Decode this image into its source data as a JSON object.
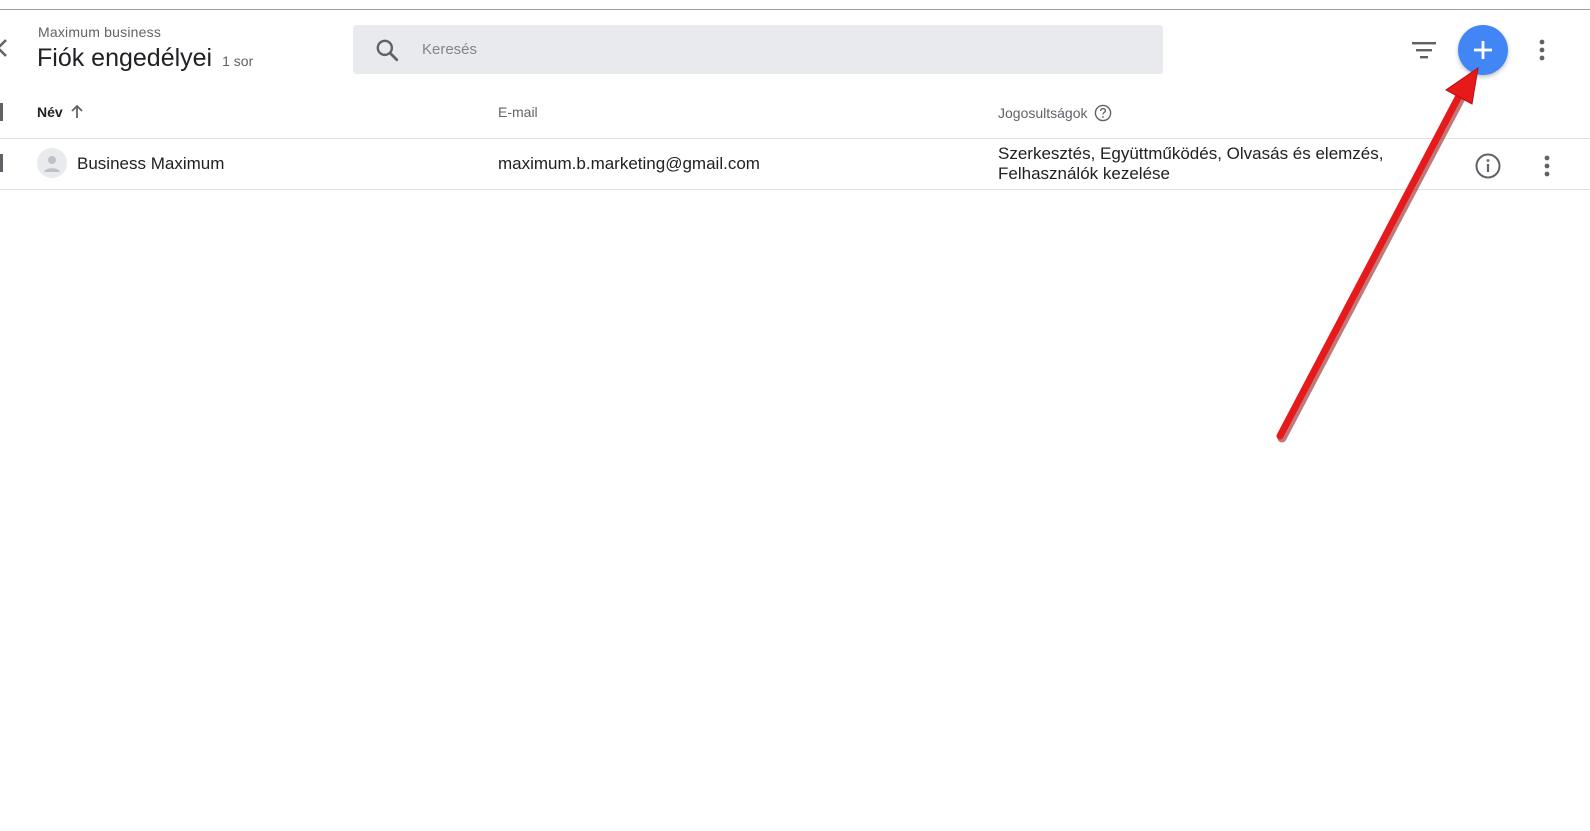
{
  "header": {
    "account_name": "Maximum business",
    "title": "Fiók engedélyei",
    "row_count": "1 sor"
  },
  "search": {
    "placeholder": "Keresés",
    "value": ""
  },
  "toolbar": {
    "filter_icon": "filter-icon",
    "add_icon": "plus-icon",
    "more_icon": "more-vert-icon",
    "accent_color": "#4285f4"
  },
  "table": {
    "columns": [
      {
        "label": "Név",
        "sorted": "ascending"
      },
      {
        "label": "E-mail"
      },
      {
        "label": "Jogosultságok",
        "help_icon": "help-icon"
      }
    ],
    "rows": [
      {
        "name": "Business Maximum",
        "email": "maximum.b.marketing@gmail.com",
        "permissions_line1": "Szerkesztés, Együttműködés, Olvasás és elemzés,",
        "permissions_line2": "Felhasználók kezelése",
        "info_icon": "info-icon",
        "more_icon": "more-vert-icon"
      }
    ]
  },
  "annotation": {
    "arrow_color": "#e8191b",
    "points_to": "add-button"
  }
}
